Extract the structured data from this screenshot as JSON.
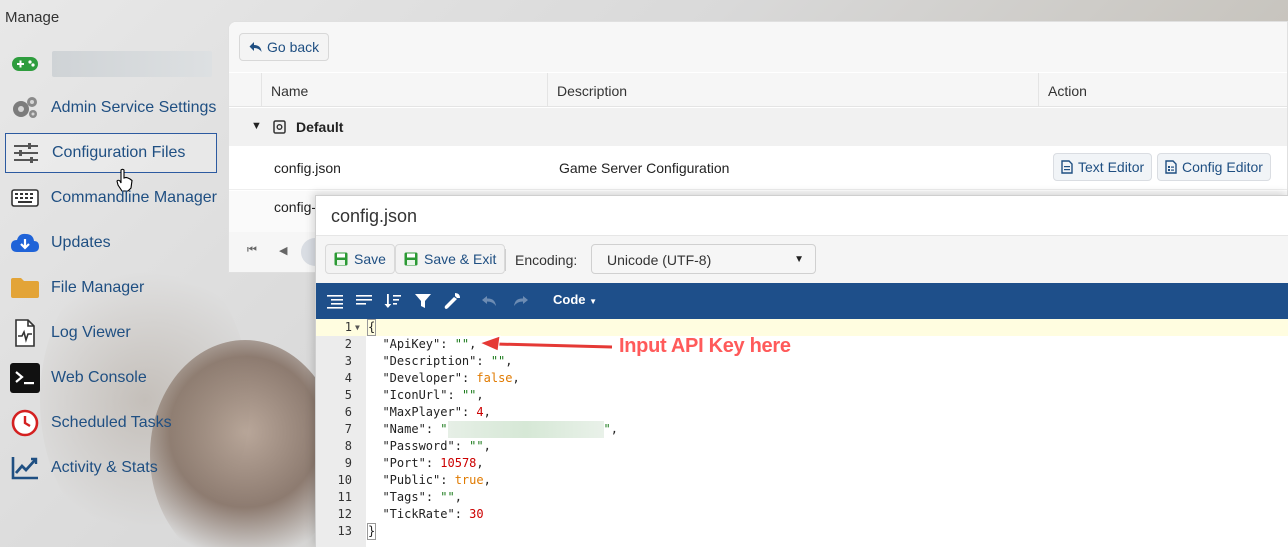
{
  "sidebar": {
    "title": "Manage",
    "items": [
      {
        "label": "",
        "icon": "gamepad-icon"
      },
      {
        "label": "Admin Service Settings",
        "icon": "gears-icon"
      },
      {
        "label": "Configuration Files",
        "icon": "sliders-icon",
        "active": true
      },
      {
        "label": "Commandline Manager",
        "icon": "keyboard-icon"
      },
      {
        "label": "Updates",
        "icon": "cloud-download-icon"
      },
      {
        "label": "File Manager",
        "icon": "folder-icon"
      },
      {
        "label": "Log Viewer",
        "icon": "file-pulse-icon"
      },
      {
        "label": "Web Console",
        "icon": "terminal-icon"
      },
      {
        "label": "Scheduled Tasks",
        "icon": "clock-icon"
      },
      {
        "label": "Activity & Stats",
        "icon": "chart-line-icon"
      }
    ]
  },
  "config_panel": {
    "go_back": "Go back",
    "columns": [
      "Name",
      "Description",
      "Action"
    ],
    "group": "Default",
    "rows": [
      {
        "name": "config.json",
        "description": "Game Server Configuration",
        "actions": [
          "Text Editor",
          "Config Editor"
        ]
      },
      {
        "name": "config-",
        "description": "",
        "actions": []
      }
    ]
  },
  "editor": {
    "title": "config.json",
    "save_label": "Save",
    "save_exit_label": "Save & Exit",
    "encoding_label": "Encoding:",
    "encoding_value": "Unicode (UTF-8)",
    "code_menu": "Code",
    "lines": [
      {
        "n": "1",
        "text": "{"
      },
      {
        "n": "2",
        "key": "\"ApiKey\"",
        "val": "\"\"",
        "type": "str"
      },
      {
        "n": "3",
        "key": "\"Description\"",
        "val": "\"\"",
        "type": "str"
      },
      {
        "n": "4",
        "key": "\"Developer\"",
        "val": "false",
        "type": "bool"
      },
      {
        "n": "5",
        "key": "\"IconUrl\"",
        "val": "\"\"",
        "type": "str"
      },
      {
        "n": "6",
        "key": "\"MaxPlayer\"",
        "val": "4",
        "type": "num"
      },
      {
        "n": "7",
        "key": "\"Name\"",
        "val": "\"",
        "type": "str"
      },
      {
        "n": "8",
        "key": "\"Password\"",
        "val": "\"\"",
        "type": "str"
      },
      {
        "n": "9",
        "key": "\"Port\"",
        "val": "10578",
        "type": "num"
      },
      {
        "n": "10",
        "key": "\"Public\"",
        "val": "true",
        "type": "bool"
      },
      {
        "n": "11",
        "key": "\"Tags\"",
        "val": "\"\"",
        "type": "str"
      },
      {
        "n": "12",
        "key": "\"TickRate\"",
        "val": "30",
        "type": "num",
        "last": true
      },
      {
        "n": "13",
        "text": "}"
      }
    ]
  },
  "annotation": "Input API Key here",
  "colors": {
    "accent": "#1e4f8a",
    "link": "#1f4f82",
    "annotation": "#ff5a5a"
  }
}
